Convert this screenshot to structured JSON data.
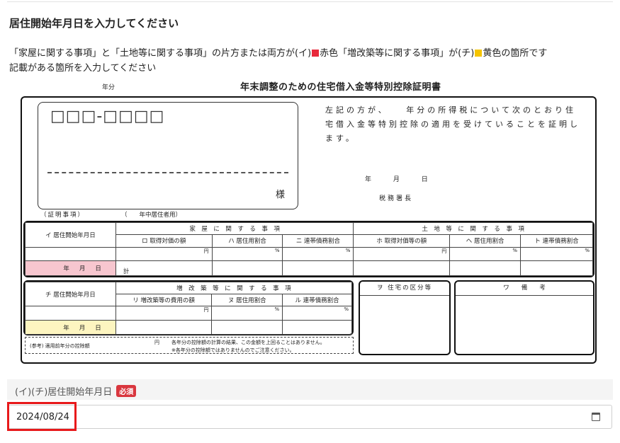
{
  "page": {
    "title": "居住開始年月日を入力してください",
    "desc_line1_a": "「家屋に関する事項」と「土地等に関する事項」の片方または両方が(イ)",
    "desc_red_label": "赤色",
    "desc_line1_b": "「増改築等に関する事項」が(チ)",
    "desc_yellow_label": "黄色の箇所です",
    "desc_line2": "記載がある箇所を入力してください",
    "colors": {
      "red": "#e8293b",
      "yellow": "#f5c400",
      "highlight": "#e8191b",
      "required": "#d9363e"
    }
  },
  "certificate": {
    "year_label": "年分",
    "title": "年末調整のための住宅借入金等特別控除証明書",
    "postal": "□□□-□□□□",
    "honorific": "様",
    "text": "左記の方が、　　年分の所得税について次のとおり住宅借入金等特別控除の適用を受けていることを証明します。",
    "date_line": "年 月 日",
    "tax_office": "税務署長",
    "kou_label": "（証明事項）",
    "kou_note": "（　　年中居住者用）",
    "t1": {
      "i_label": "イ 居住開始年月日",
      "house_header": "家　屋　に　関　す　る　事　項",
      "land_header": "土　地　等　に　関　す　る　事　項",
      "ro": "ロ 取得対価の額",
      "ha": "ハ 居住用割合",
      "ni": "ニ 連帯債務割合",
      "ho": "ホ 取得対価等の額",
      "he": "ヘ 居住用割合",
      "to": "ト 連帯債務割合",
      "yen": "円",
      "pct": "%",
      "ymd": "年月日",
      "kei": "計"
    },
    "t2": {
      "chi_label": "チ 居住開始年月日",
      "header": "増　改　築　等　に　関　す　る　事　項",
      "ri": "リ 増改築等の費用の額",
      "nu": "ヌ 居住用割合",
      "ru": "ル 連帯債務割合",
      "yen": "円",
      "pct": "%",
      "ymd": "年月日"
    },
    "wo": "ヲ 住宅の区分等",
    "wa": "ワ　　備　　考",
    "ref": {
      "label": "(参考) 適用前年分の控除額",
      "yen": "円",
      "note1": "各年分の控除額の計算の結果、この金額を上回ることはありません。",
      "note2": "※各年分の控除額ではありませんのでご注意ください。"
    }
  },
  "field": {
    "label": "(イ)(チ)居住開始年月日",
    "required": "必須",
    "value": "2024/08/24"
  }
}
